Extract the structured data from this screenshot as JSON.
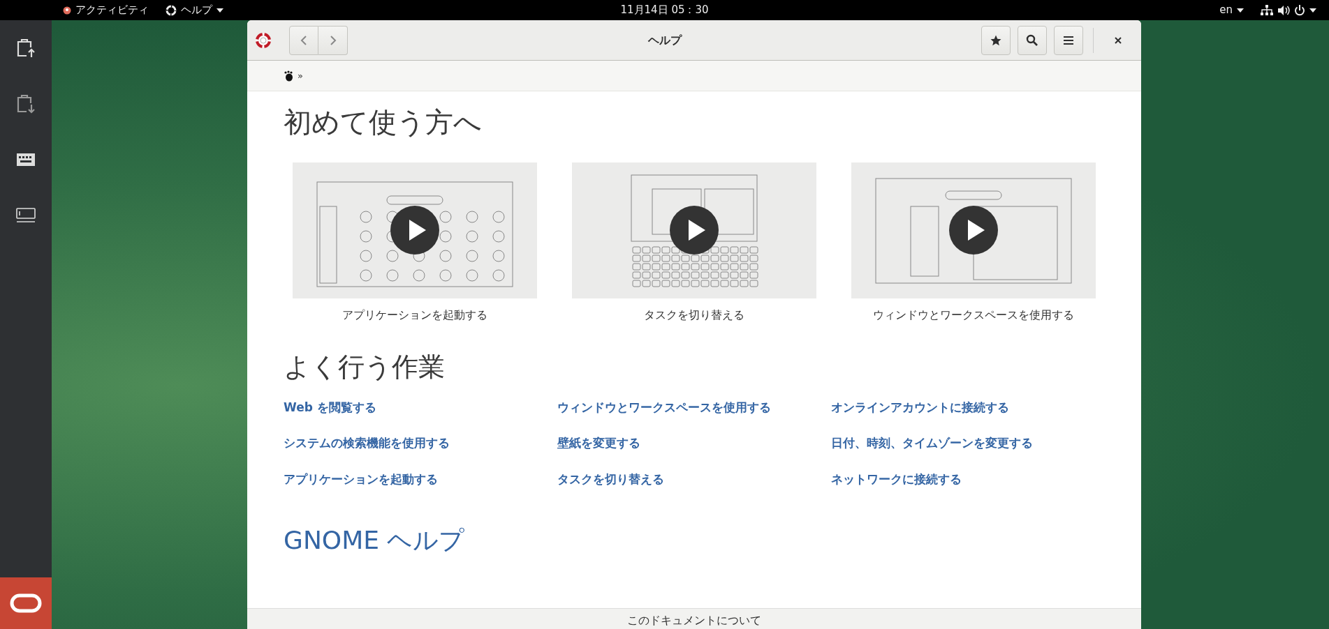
{
  "top_bar": {
    "activities": "アクティビティ",
    "app_menu": "ヘルプ",
    "clock": "11月14日 05：30",
    "input_source": "en"
  },
  "window": {
    "title": "ヘルプ",
    "breadcrumb": "»"
  },
  "sections": [
    {
      "kind": "videos",
      "heading": "初めて使う方へ",
      "items": [
        {
          "caption": "アプリケーションを起動する",
          "kind": "apps"
        },
        {
          "caption": "タスクを切り替える",
          "kind": "keyboard"
        },
        {
          "caption": "ウィンドウとワークスペースを使用する",
          "kind": "windows"
        }
      ]
    },
    {
      "kind": "links",
      "heading": "よく行う作業",
      "columns": [
        [
          "Web を閲覧する",
          "システムの検索機能を使用する",
          "アプリケーションを起動する"
        ],
        [
          "ウィンドウとワークスペースを使用する",
          "壁紙を変更する",
          "タスクを切り替える"
        ],
        [
          "オンラインアカウントに接続する",
          "日付、時刻、タイムゾーンを変更する",
          "ネットワークに接続する"
        ]
      ]
    },
    {
      "kind": "link_heading",
      "heading": "GNOME ヘルプ"
    }
  ],
  "footer": "このドキュメントについて"
}
